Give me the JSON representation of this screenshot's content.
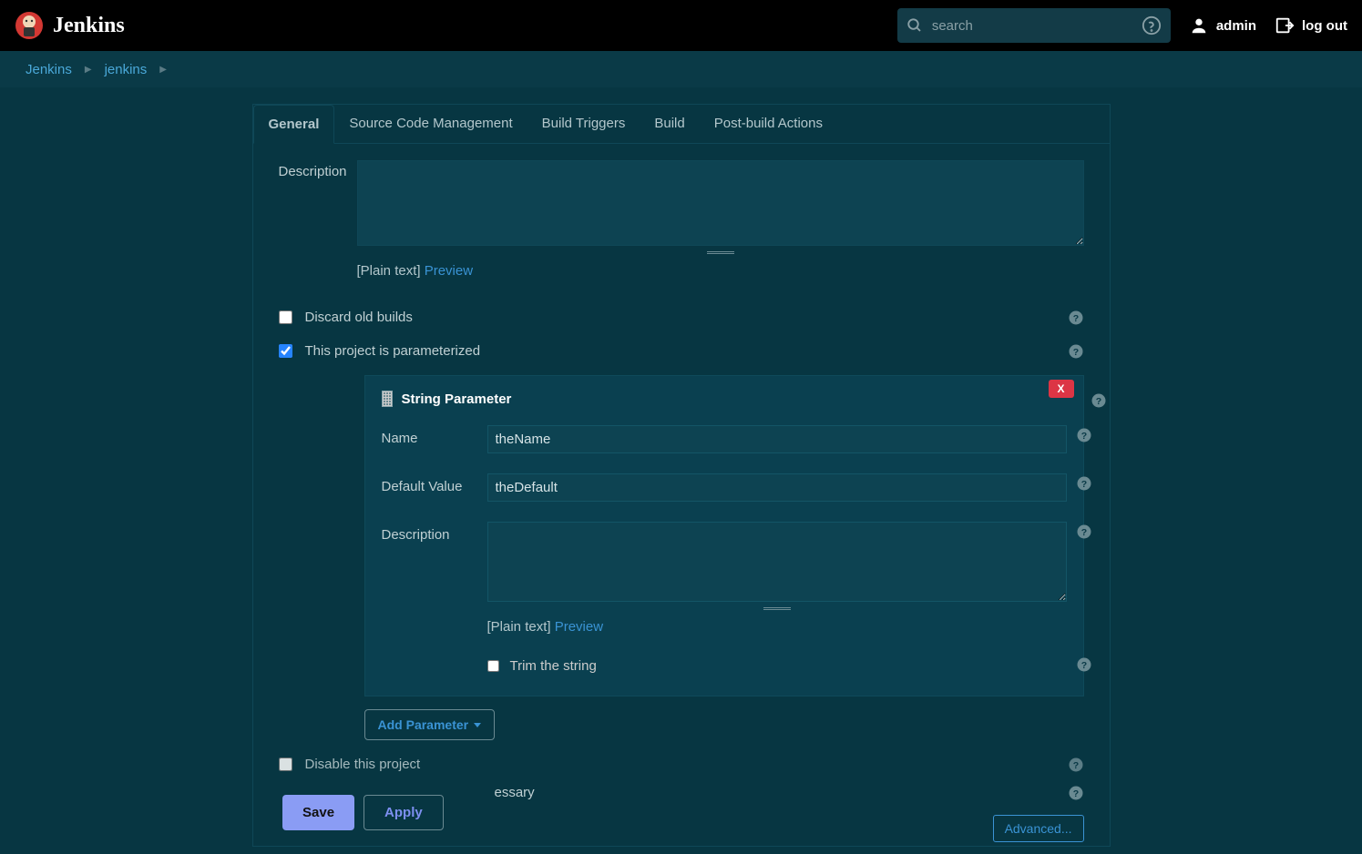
{
  "header": {
    "logo_text": "Jenkins",
    "search_placeholder": "search",
    "user": "admin",
    "logout": "log out"
  },
  "breadcrumbs": [
    {
      "label": "Jenkins"
    },
    {
      "label": "jenkins"
    }
  ],
  "tabs": [
    {
      "label": "General",
      "active": true
    },
    {
      "label": "Source Code Management",
      "active": false
    },
    {
      "label": "Build Triggers",
      "active": false
    },
    {
      "label": "Build",
      "active": false
    },
    {
      "label": "Post-build Actions",
      "active": false
    }
  ],
  "form": {
    "description_label": "Description",
    "plain_text_label": "[Plain text]",
    "preview_label": "Preview",
    "discard_old_builds": {
      "label": "Discard old builds",
      "checked": false
    },
    "parameterized": {
      "label": "This project is parameterized",
      "checked": true
    },
    "string_param": {
      "title": "String Parameter",
      "delete": "X",
      "name_label": "Name",
      "name_value": "theName",
      "default_label": "Default Value",
      "default_value": "theDefault",
      "description_label": "Description",
      "plain_text_label": "[Plain text]",
      "preview_label": "Preview",
      "trim": {
        "label": "Trim the string",
        "checked": false
      }
    },
    "add_parameter": "Add Parameter",
    "disable_project": {
      "label": "Disable this project",
      "checked": false
    },
    "execute_concurrent_fragment": "essary",
    "advanced": "Advanced..."
  },
  "footer": {
    "save": "Save",
    "apply": "Apply"
  }
}
